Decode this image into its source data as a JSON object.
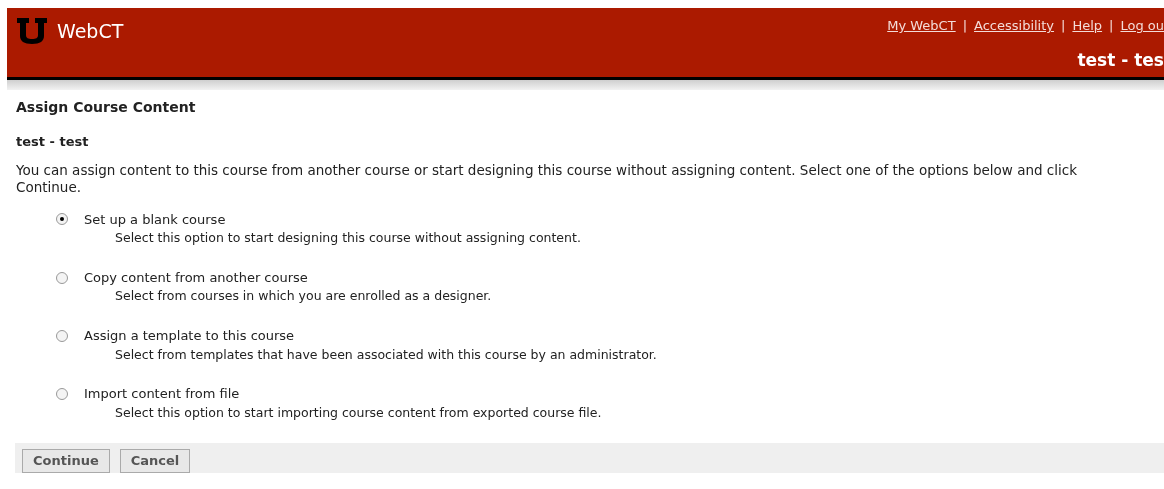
{
  "header": {
    "logo": "WebCT",
    "links": [
      "My WebCT",
      "Accessibility",
      "Help",
      "Log ou"
    ],
    "separators": [
      "|",
      "|",
      "|"
    ],
    "course": "test - tes"
  },
  "page": {
    "title": "Assign Course Content",
    "course": "test - test",
    "intro": "You can assign content to this course from another course or start designing this course without assigning content. Select one of the options below and click Continue."
  },
  "options": [
    {
      "label": "Set up a blank course",
      "description": "Select this option to start designing this course without assigning content.",
      "selected": true
    },
    {
      "label": "Copy content from another course",
      "description": "Select from courses in which you are enrolled as a designer.",
      "selected": false
    },
    {
      "label": "Assign a template to this course",
      "description": "Select from templates that have been associated with this course by an administrator.",
      "selected": false
    },
    {
      "label": "Import content from file",
      "description": "Select this option to start importing course content from exported course file.",
      "selected": false
    }
  ],
  "buttons": [
    "Continue",
    "Cancel"
  ]
}
